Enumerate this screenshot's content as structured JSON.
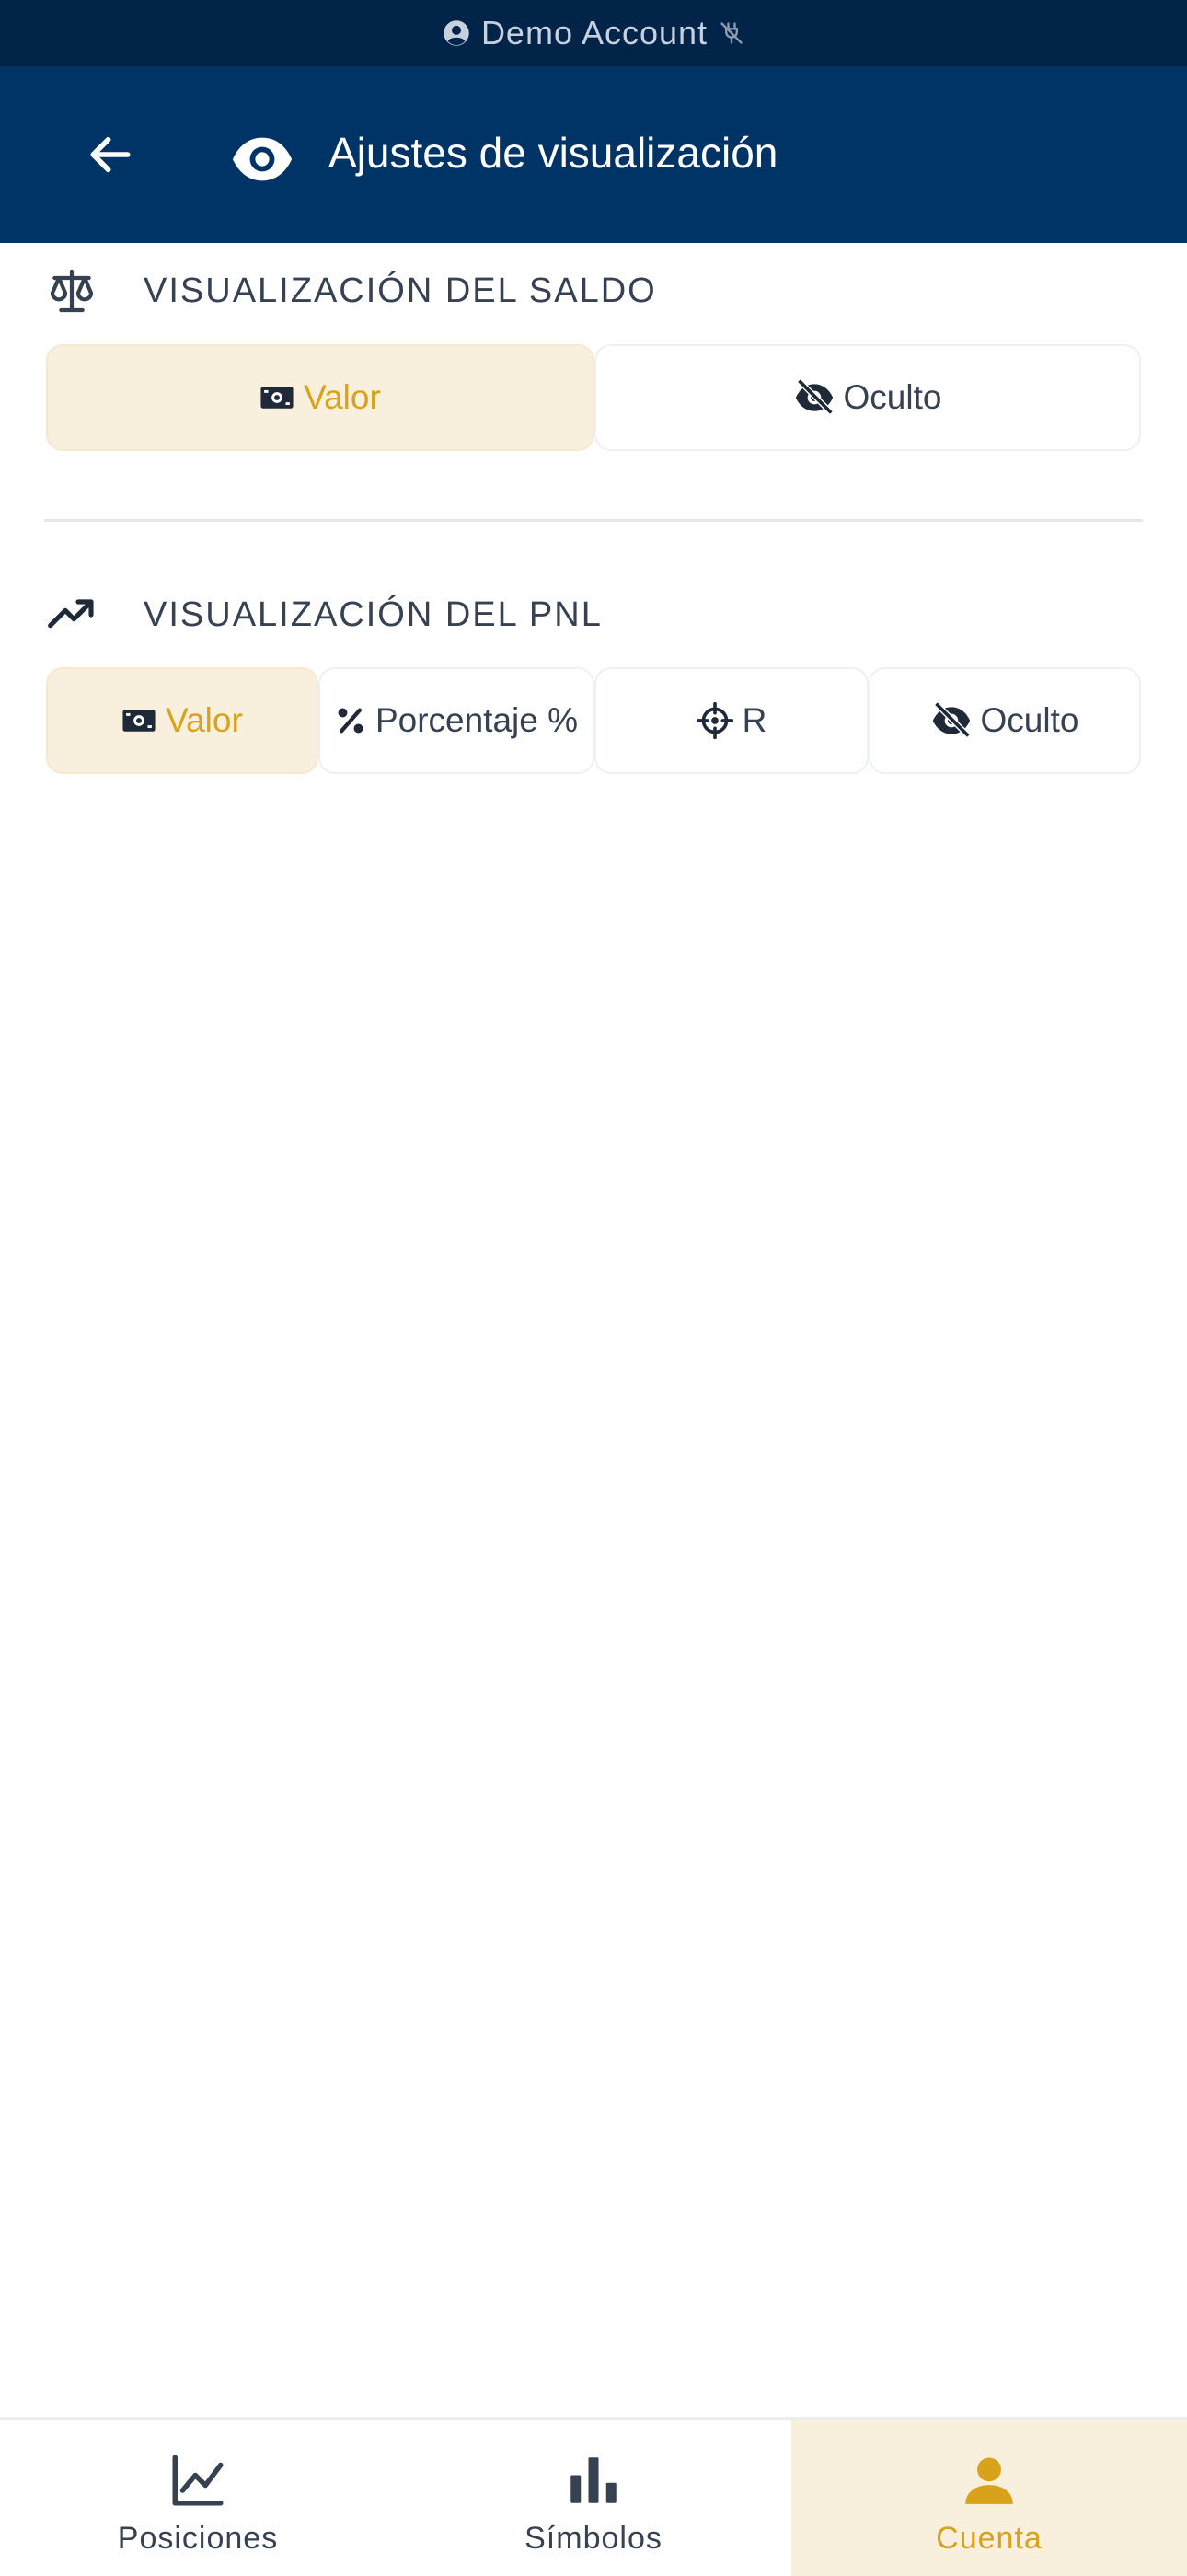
{
  "status_bar": {
    "account_label": "Demo Account",
    "user_icon": "user-circle-icon",
    "connection_icon": "plug-off-icon"
  },
  "header": {
    "title": "Ajustes de visualización",
    "back_icon": "arrow-left-icon",
    "title_icon": "eye-icon",
    "background_color": "#003366"
  },
  "sections": [
    {
      "label": "VISUALIZACIÓN DEL SALDO",
      "icon": "balance-scale-icon",
      "options": [
        {
          "label": "Valor",
          "icon": "money-bill-icon",
          "selected": true
        },
        {
          "label": "Oculto",
          "icon": "eye-slash-icon",
          "selected": false
        }
      ]
    },
    {
      "label": "VISUALIZACIÓN DEL PNL",
      "icon": "trending-up-icon",
      "options": [
        {
          "label": "Valor",
          "icon": "money-bill-icon",
          "selected": true
        },
        {
          "label": "Porcentaje %",
          "icon": "percent-icon",
          "selected": false
        },
        {
          "label": "R",
          "icon": "crosshairs-icon",
          "selected": false
        },
        {
          "label": "Oculto",
          "icon": "eye-slash-icon",
          "selected": false
        }
      ]
    }
  ],
  "bottom_nav": [
    {
      "label": "Posiciones",
      "icon": "line-chart-icon",
      "active": false
    },
    {
      "label": "Símbolos",
      "icon": "bar-chart-icon",
      "active": false
    },
    {
      "label": "Cuenta",
      "icon": "user-icon",
      "active": true
    }
  ],
  "colors": {
    "accent": "#d9a21b",
    "accent_bg": "#f8efdc",
    "status_bar_bg": "#022448",
    "text": "#364152"
  }
}
